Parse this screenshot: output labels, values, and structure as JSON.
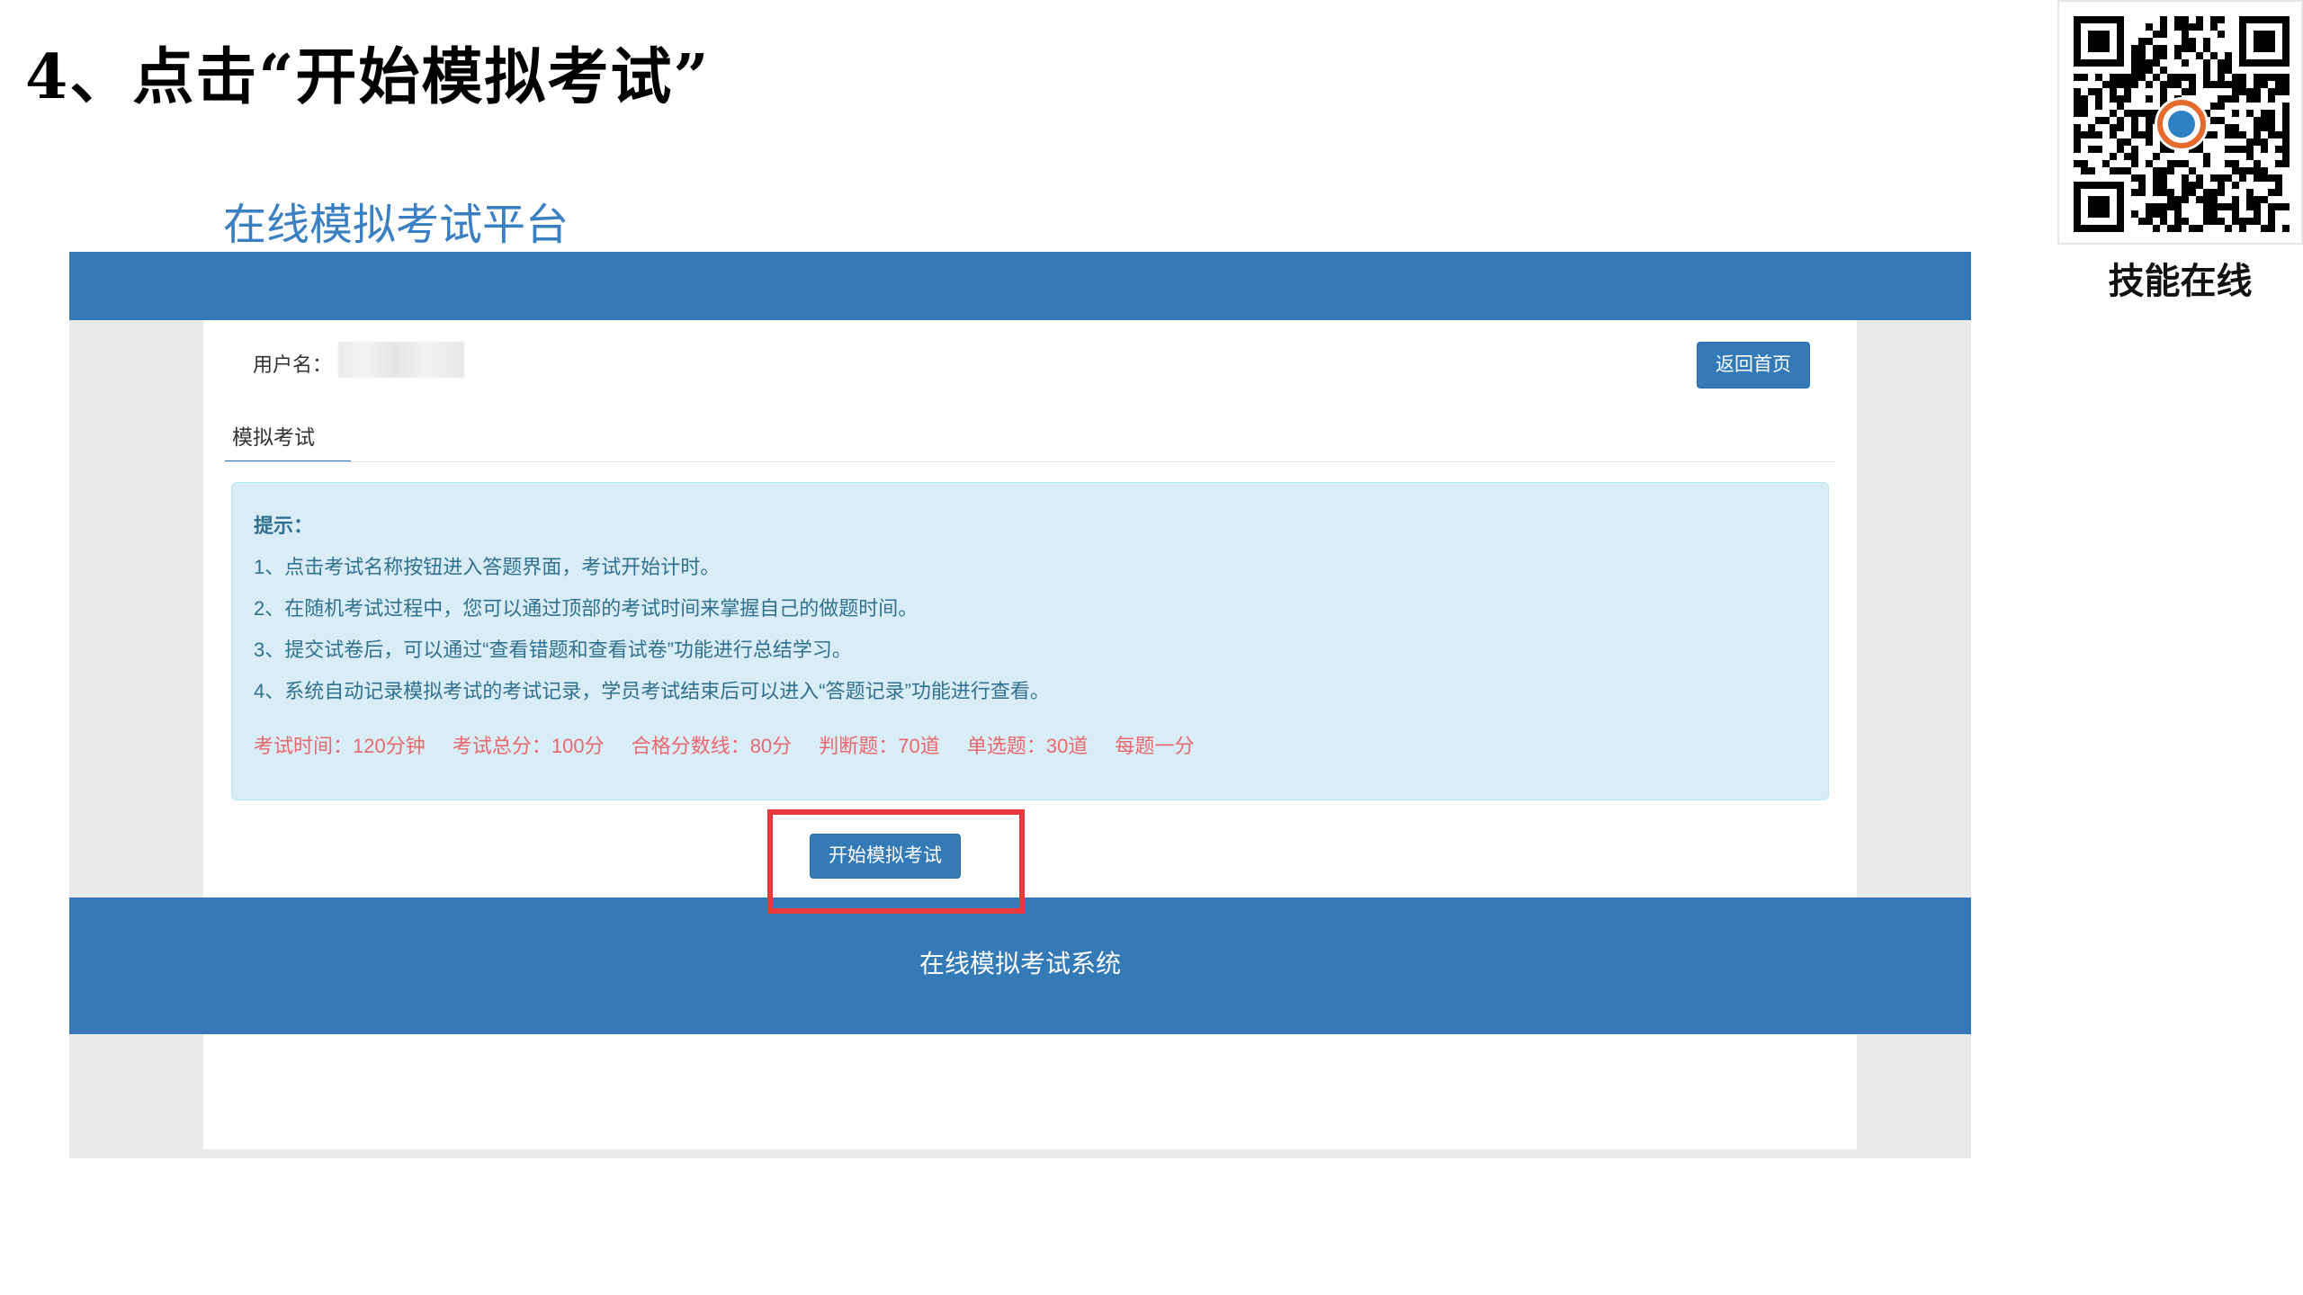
{
  "slide": {
    "title": "4、点击“开始模拟考试”"
  },
  "qr": {
    "caption": "技能在线"
  },
  "platform": {
    "title": "在线模拟考试平台"
  },
  "header": {
    "username_label": "用户名：",
    "back_home_label": "返回首页"
  },
  "tabs": [
    {
      "label": "模拟考试"
    }
  ],
  "tips": {
    "title": "提示：",
    "lines": [
      "1、点击考试名称按钮进入答题界面，考试开始计时。",
      "2、在随机考试过程中，您可以通过顶部的考试时间来掌握自己的做题时间。",
      "3、提交试卷后，可以通过“查看错题和查看试卷”功能进行总结学习。",
      "4、系统自动记录模拟考试的考试记录，学员考试结束后可以进入“答题记录”功能进行查看。"
    ]
  },
  "exam_info": {
    "time": "考试时间：120分钟",
    "total": "考试总分：100分",
    "pass": "合格分数线：80分",
    "judge": "判断题：70道",
    "single": "单选题：30道",
    "per": "每题一分"
  },
  "start_button_label": "开始模拟考试",
  "footer": {
    "text": "在线模拟考试系统"
  },
  "colors": {
    "primary": "#337ab7",
    "highlight": "#e8393c",
    "info_bg": "#d9edf7",
    "info_text": "#31708f",
    "exam_info": "#e9686d"
  }
}
